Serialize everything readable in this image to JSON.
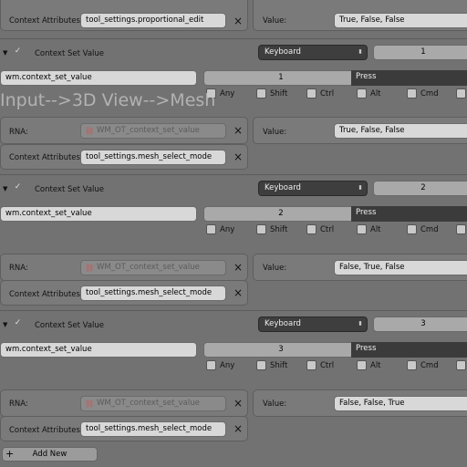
{
  "top": {
    "context_attributes_label": "Context Attributes:",
    "context_attributes_value": "tool_settings.proportional_edit",
    "value_label": "Value:",
    "value_value": "True, False, False"
  },
  "overlay_text": "Input-->3D View-->Mesh",
  "items": [
    {
      "title": "Context Set Value",
      "event_type": "Keyboard",
      "key_number": "1",
      "operator": "wm.context_set_value",
      "key": "1",
      "press": "Press",
      "modifiers": [
        "Any",
        "Shift",
        "Ctrl",
        "Alt",
        "Cmd"
      ],
      "rna_label": "RNA:",
      "rna_value": "WM_OT_context_set_value",
      "value_label": "Value:",
      "value_value": "True, False, False",
      "ctx_label": "Context Attributes:",
      "ctx_value": "tool_settings.mesh_select_mode"
    },
    {
      "title": "Context Set Value",
      "event_type": "Keyboard",
      "key_number": "2",
      "operator": "wm.context_set_value",
      "key": "2",
      "press": "Press",
      "modifiers": [
        "Any",
        "Shift",
        "Ctrl",
        "Alt",
        "Cmd"
      ],
      "rna_label": "RNA:",
      "rna_value": "WM_OT_context_set_value",
      "value_label": "Value:",
      "value_value": "False, True, False",
      "ctx_label": "Context Attributes:",
      "ctx_value": "tool_settings.mesh_select_mode"
    },
    {
      "title": "Context Set Value",
      "event_type": "Keyboard",
      "key_number": "3",
      "operator": "wm.context_set_value",
      "key": "3",
      "press": "Press",
      "modifiers": [
        "Any",
        "Shift",
        "Ctrl",
        "Alt",
        "Cmd"
      ],
      "rna_label": "RNA:",
      "rna_value": "WM_OT_context_set_value",
      "value_label": "Value:",
      "value_value": "False, False, True",
      "ctx_label": "Context Attributes:",
      "ctx_value": "tool_settings.mesh_select_mode"
    }
  ],
  "add_new_label": "Add New",
  "icons": {
    "close": "×",
    "disclosure": "▼",
    "check": "✓",
    "updown": "⬍",
    "plus": "+"
  }
}
